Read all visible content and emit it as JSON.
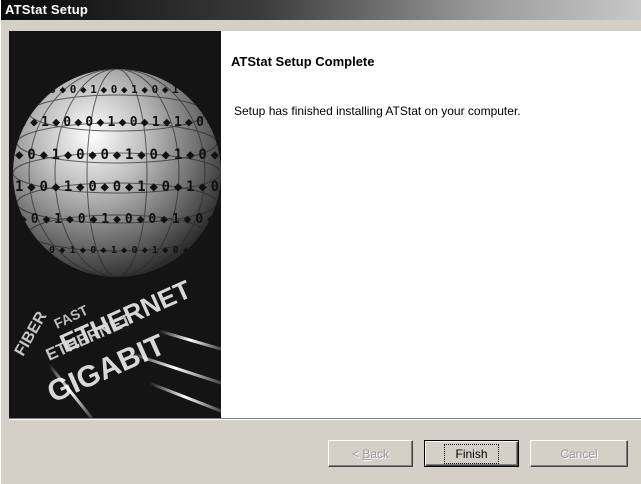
{
  "window": {
    "title": "ATStat Setup"
  },
  "main": {
    "heading": "ATStat Setup Complete",
    "message": "Setup has finished installing ATStat on your computer."
  },
  "banner": {
    "words": [
      "ETHERNET",
      "FAST",
      "ETHERNET",
      "GIGABIT",
      "FIBER"
    ],
    "rows": [
      "0100101101",
      "0101001010",
      "1001001010",
      "0101110100",
      "0101001010",
      "1010100101"
    ]
  },
  "buttons": {
    "back_prefix": "< ",
    "back_mnemonic": "B",
    "back_rest": "ack",
    "finish": "Finish",
    "cancel": "Cancel"
  }
}
